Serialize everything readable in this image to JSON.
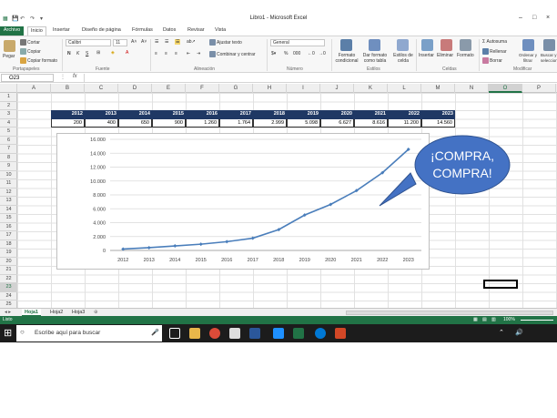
{
  "window": {
    "title": "Libro1 - Microsoft Excel",
    "controls": [
      "–",
      "□",
      "×"
    ]
  },
  "ribbon_tabs": [
    "Archivo",
    "Inicio",
    "Insertar",
    "Diseño de página",
    "Fórmulas",
    "Datos",
    "Revisar",
    "Vista"
  ],
  "ribbon": {
    "paste": "Pegar",
    "cut": "Cortar",
    "copy": "Copiar",
    "copy_format": "Copiar formato",
    "clipboard_group": "Portapapeles",
    "font_name": "Calibri",
    "font_size": "11",
    "bold": "N",
    "italic": "K",
    "underline": "S",
    "font_group": "Fuente",
    "wrap_text": "Ajustar texto",
    "merge_center": "Combinar y centrar",
    "alignment_group": "Alineación",
    "number_format": "General",
    "percent": "%",
    "thousands": "000",
    "number_group": "Número",
    "cond_format": "Formato condicional",
    "format_table": "Dar formato como tabla",
    "cell_styles": "Estilos de celda",
    "styles_group": "Estilos",
    "insert": "Insertar",
    "delete": "Eliminar",
    "format": "Formato",
    "cells_group": "Celdas",
    "autosum": "Autosuma",
    "fill": "Rellenar",
    "clear": "Borrar",
    "sort_filter": "Ordenar y filtrar",
    "find_select": "Buscar y seleccionar",
    "modify_group": "Modificar"
  },
  "formula_bar": {
    "name_box": "O23",
    "fx": "fx",
    "content": ""
  },
  "columns": [
    "A",
    "B",
    "C",
    "D",
    "E",
    "F",
    "G",
    "H",
    "I",
    "J",
    "K",
    "L",
    "M",
    "N",
    "O",
    "P"
  ],
  "rows": [
    "1",
    "2",
    "3",
    "4",
    "5",
    "6",
    "7",
    "8",
    "9",
    "10",
    "11",
    "12",
    "13",
    "14",
    "15",
    "16",
    "17",
    "18",
    "19",
    "20",
    "21",
    "22",
    "23",
    "24",
    "25"
  ],
  "table": {
    "years": [
      "2012",
      "2013",
      "2014",
      "2015",
      "2016",
      "2017",
      "2018",
      "2019",
      "2020",
      "2021",
      "2022",
      "2023"
    ],
    "values": [
      "200",
      "400",
      "650",
      "900",
      "1.260",
      "1.764",
      "2.999",
      "5.098",
      "6.627",
      "8.616",
      "11.200",
      "14.560"
    ]
  },
  "callout": {
    "line1": "¡COMPRA,",
    "line2": "COMPRA!"
  },
  "chart_data": {
    "type": "line",
    "categories": [
      "2012",
      "2013",
      "2014",
      "2015",
      "2016",
      "2017",
      "2018",
      "2019",
      "2020",
      "2021",
      "2022",
      "2023"
    ],
    "values": [
      200,
      400,
      650,
      900,
      1260,
      1764,
      2999,
      5098,
      6627,
      8616,
      11200,
      14560
    ],
    "yticks": [
      "0",
      "2.000",
      "4.000",
      "6.000",
      "8.000",
      "10.000",
      "12.000",
      "14.000",
      "16.000"
    ],
    "ylim": [
      0,
      16000
    ],
    "grid": true,
    "color": "#4a7ebb"
  },
  "sheets": [
    "Hoja1",
    "Hoja2",
    "Hoja3"
  ],
  "status": {
    "ready": "Listo",
    "zoom": "100%"
  },
  "taskbar": {
    "search_placeholder": "Escribe aquí para buscar"
  }
}
